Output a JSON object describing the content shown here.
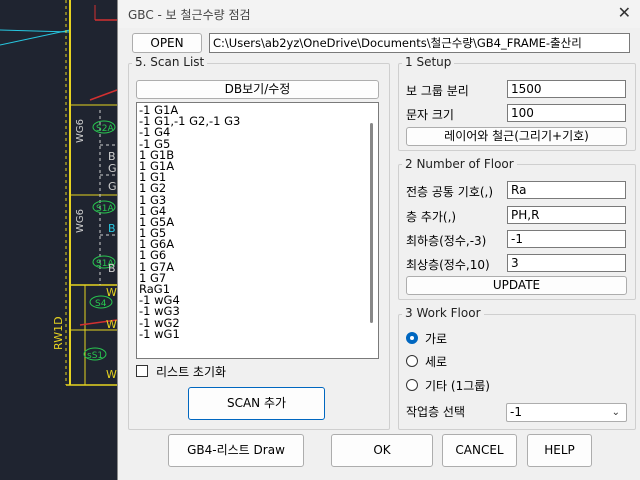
{
  "window": {
    "title": "GBC - 보 철근수량 점검",
    "close_label": "✕"
  },
  "open_button": "OPEN",
  "file_path": "C:\\Users\\ab2yz\\OneDrive\\Documents\\철근수량\\GB4_FRAME-출산리",
  "scan_list": {
    "group_label": "5. Scan  List",
    "db_button": "DB보기/수정",
    "items": [
      "-1 G1A",
      "-1 G1,-1 G2,-1 G3",
      "-1 G4",
      "-1 G5",
      "1 G1B",
      "1 G1A",
      "1 G1",
      "1 G2",
      "1 G3",
      "1 G4",
      "1 G5A",
      "1 G5",
      "1 G6A",
      "1 G6",
      "1 G7A",
      "1 G7",
      "RaG1",
      "-1 wG4",
      "-1 wG3",
      "-1 wG2",
      "-1 wG1"
    ],
    "reset_label": "리스트 초기화",
    "scan_add_button": "SCAN 추가"
  },
  "setup": {
    "group_label": "1 Setup",
    "beam_group_label": "보 그룹 분리",
    "beam_group_value": "1500",
    "text_size_label": "문자 크기",
    "text_size_value": "100",
    "layer_button": "레이어와 철근(그리기+기호)"
  },
  "floor": {
    "group_label": "2 Number of Floor",
    "prefix_label": "전층 공통 기호(,)",
    "prefix_value": "Ra",
    "add_label": "층    추가(,)",
    "add_value": "PH,R",
    "lowest_label": "최하층(정수,-3)",
    "lowest_value": "-1",
    "highest_label": "최상층(정수,10)",
    "highest_value": "3",
    "update_button": "UPDATE"
  },
  "work_floor": {
    "group_label": "3 Work Floor",
    "options": [
      "가로",
      "세로",
      "기타 (1그룹)"
    ],
    "selected_index": 0,
    "select_label": "작업층 선택",
    "select_value": "-1"
  },
  "footer": {
    "draw_button": "GB4-리스트 Draw",
    "ok_button": "OK",
    "cancel_button": "CANCEL",
    "help_button": "HELP"
  },
  "cad_labels": {
    "wg6_a": "WG6",
    "wg6_b": "WG6",
    "s2a": "S2A",
    "s1a_a": "S1A",
    "s1a_b": "S1A",
    "s4": "S4",
    "s51": "sS1",
    "rw1d": "RW1D",
    "w1": "W",
    "w2": "W",
    "w3": "W",
    "b1": "B",
    "c1": "G",
    "b2": "B",
    "g2": "G",
    "b3": "B"
  },
  "colors": {
    "accent": "#0067c0",
    "cad_bg": "#1f2430",
    "cad_yellow": "#e6d320",
    "cad_green": "#28c850",
    "cad_cyan": "#27c7e0"
  }
}
